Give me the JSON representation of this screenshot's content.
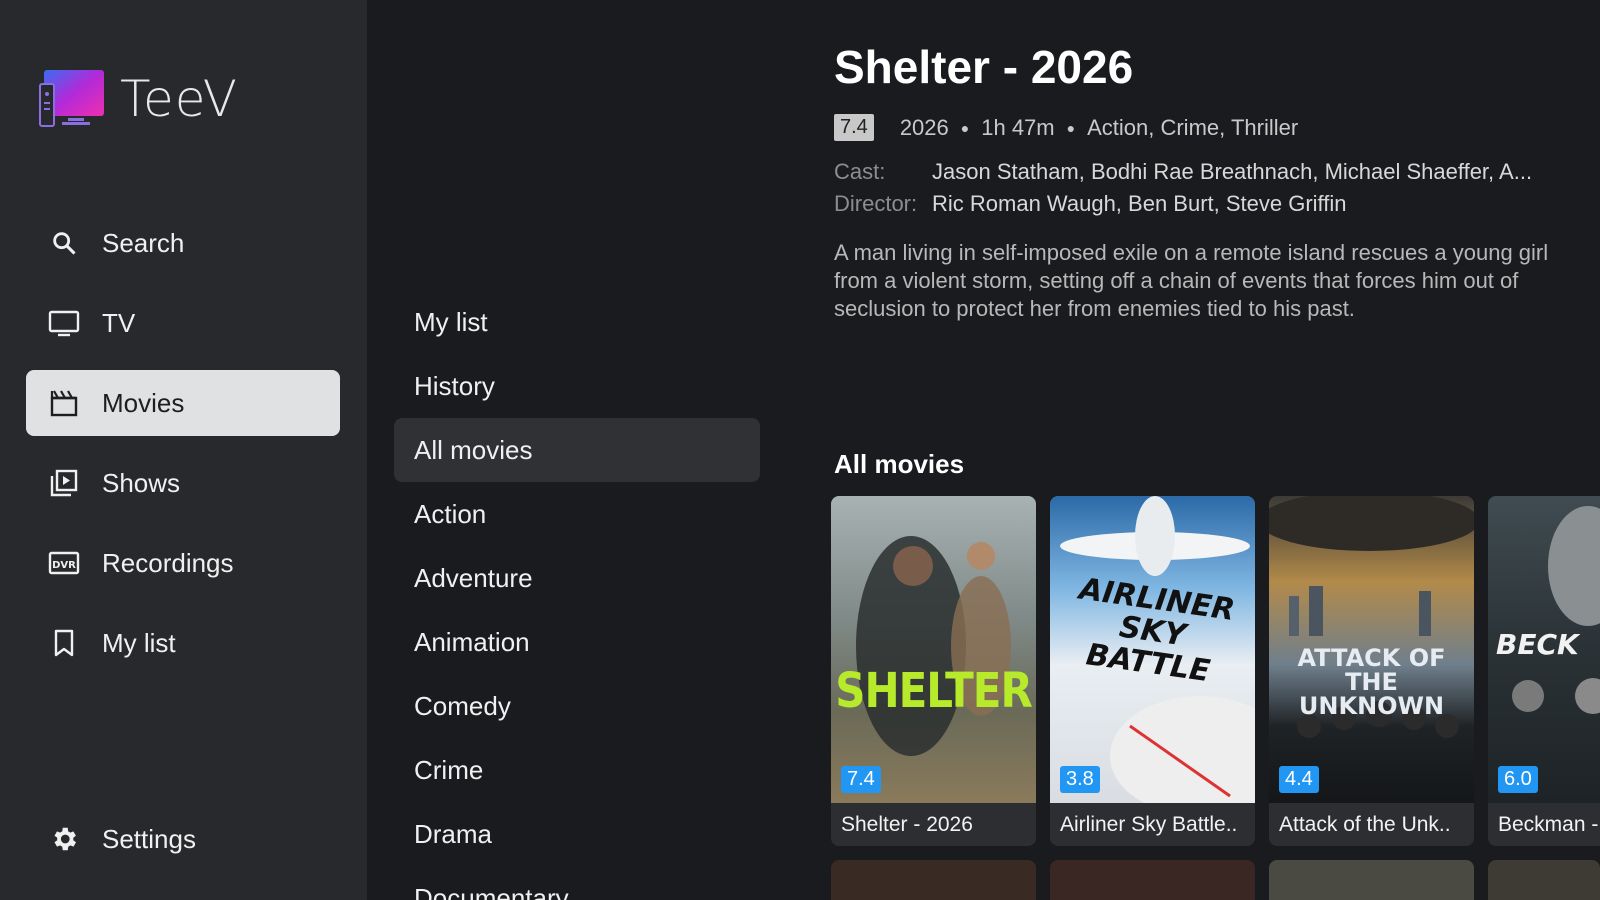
{
  "app": {
    "name": "TeeV"
  },
  "nav": {
    "items": [
      {
        "label": "Search",
        "icon": "search-icon"
      },
      {
        "label": "TV",
        "icon": "tv-icon"
      },
      {
        "label": "Movies",
        "icon": "clapperboard-icon",
        "active": true
      },
      {
        "label": "Shows",
        "icon": "play-library-icon"
      },
      {
        "label": "Recordings",
        "icon": "dvr-icon"
      },
      {
        "label": "My list",
        "icon": "bookmark-icon"
      }
    ],
    "settings": {
      "label": "Settings",
      "icon": "gear-icon"
    }
  },
  "categories": [
    {
      "label": "My list"
    },
    {
      "label": "History"
    },
    {
      "label": "All movies",
      "active": true
    },
    {
      "label": "Action"
    },
    {
      "label": "Adventure"
    },
    {
      "label": "Animation"
    },
    {
      "label": "Comedy"
    },
    {
      "label": "Crime"
    },
    {
      "label": "Drama"
    },
    {
      "label": "Documentary"
    }
  ],
  "detail": {
    "title": "Shelter - 2026",
    "rating": "7.4",
    "year": "2026",
    "duration": "1h 47m",
    "genres": "Action, Crime, Thriller",
    "cast_label": "Cast:",
    "cast": "Jason Statham, Bodhi Rae Breathnach, Michael Shaeffer, A...",
    "director_label": "Director:",
    "director": "Ric Roman Waugh, Ben Burt, Steve Griffin",
    "synopsis": "A man living in self-imposed exile on a remote island rescues a young girl from a violent storm, setting off a chain of events that forces him out of seclusion to protect her from enemies tied to his past."
  },
  "row": {
    "title": "All movies",
    "cards": [
      {
        "title": "Shelter - 2026",
        "rating": "7.4",
        "poster_text": "SHELTER"
      },
      {
        "title": "Airliner Sky Battle..",
        "rating": "3.8",
        "poster_text": "AIRLINER SKY BATTLE"
      },
      {
        "title": "Attack of the Unk..",
        "rating": "4.4",
        "poster_text": "ATTACK OF THE UNKNOWN"
      },
      {
        "title": "Beckman -",
        "rating": "6.0",
        "poster_text": "BECK"
      }
    ]
  },
  "colors": {
    "accent": "#2196f3",
    "sidebar": "#27292d",
    "background": "#1a1b1e"
  }
}
